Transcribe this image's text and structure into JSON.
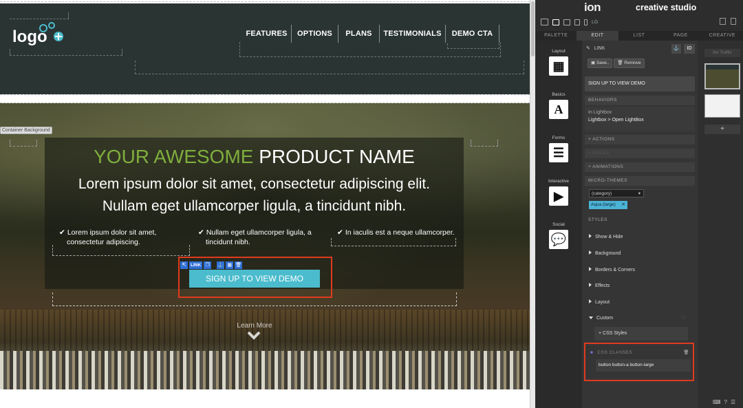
{
  "canvas": {
    "nav": {
      "logo_text": "logo",
      "items": [
        "FEATURES",
        "OPTIONS",
        "PLANS",
        "TESTIMONIALS",
        "DEMO CTA"
      ]
    },
    "hero": {
      "container_label": "Container Background",
      "title_highlight": "YOUR AWESOME",
      "title_rest": "PRODUCT NAME",
      "subtitle_line1": "Lorem ipsum dolor sit amet, consectetur adipiscing elit.",
      "subtitle_line2": "Nullam eget ullamcorper ligula, a tincidunt nibh.",
      "features": [
        {
          "line1": "Lorem ipsum dolor sit amet,",
          "line2": "consectetur adipiscing."
        },
        {
          "line1": "Nullam eget ullamcorper ligula, a",
          "line2": "tincidunt nibh."
        },
        {
          "line1": "In iaculis est a neque ullamcorper.",
          "line2": ""
        }
      ],
      "link_toolbar_label": "LINK",
      "cta_label": "SIGN UP TO VIEW DEMO",
      "learn_more": "Learn More"
    }
  },
  "panel": {
    "brand": "ion",
    "studio_label": "creative studio",
    "device_label": "LG",
    "tabs": [
      "PALETTE",
      "EDIT",
      "LIST",
      "PAGE",
      "CREATIVE"
    ],
    "palette": [
      "Layout",
      "Basics",
      "Forms",
      "Interactive",
      "Social"
    ],
    "edit": {
      "element_type": "LINK",
      "id_button": "ID",
      "save_label": "Save..",
      "remove_label": "Remove",
      "element_name": "SIGN UP TO VIEW DEMO",
      "behaviors_header": "BEHAVIORS",
      "behavior_line1": "In Lightbox",
      "behavior_line2": "Lightbox > Open LightBox",
      "actions": "+ ACTIONS",
      "rules": "+ RULES",
      "animations": "+ ANIMATIONS",
      "microthemes_header": "MICRO-THEMES",
      "category_select": "(category)",
      "theme_tag": "Aqua (large)",
      "styles_header": "STYLES",
      "styles": [
        "Show & Hide",
        "Background",
        "Borders & Corners",
        "Effects",
        "Layout"
      ],
      "custom": "Custom",
      "css_styles": "+ CSS Styles",
      "css_classes_header": "CSS CLASSES",
      "css_classes_value": "button button-a button-large"
    },
    "creative": {
      "no_traffic": "No Traffic"
    }
  },
  "colors": {
    "accent_green": "#7fae3d",
    "cta_aqua": "#4bbccd",
    "highlight_red": "#e23a1e",
    "nav_bg": "#2a3433"
  }
}
